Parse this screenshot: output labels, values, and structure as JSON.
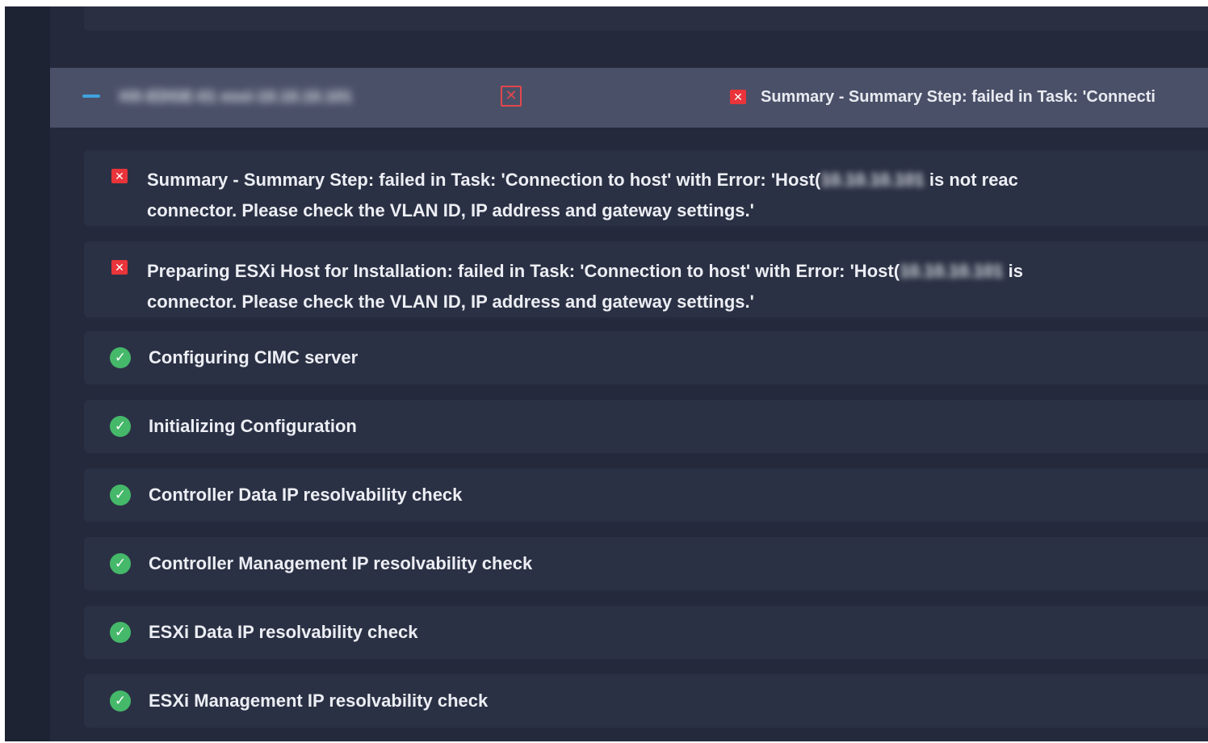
{
  "group": {
    "collapse_label": "—",
    "host_label": "HX-EDGE-01 esxi-10.10.10.101",
    "remove_icon": "✕",
    "status": {
      "icon": "error-icon",
      "message": "Summary - Summary Step: failed in Task: 'Connecti"
    }
  },
  "steps": [
    {
      "status": "error",
      "icon": "error-icon",
      "line1_pre": "Summary - Summary Step: failed in Task: 'Connection to host' with Error: 'Host(",
      "line1_redacted": "10.10.10.101",
      "line1_post": " is not reac",
      "line2": "connector. Please check the VLAN ID, IP address and gateway settings.'"
    },
    {
      "status": "error",
      "icon": "error-icon",
      "line1_pre": "Preparing ESXi Host for Installation: failed in Task: 'Connection to host' with Error: 'Host(",
      "line1_redacted": "10.10.10.101",
      "line1_post": " is",
      "line2": "connector. Please check the VLAN ID, IP address and gateway settings.'"
    },
    {
      "status": "success",
      "icon": "check-circle-icon",
      "label": "Configuring CIMC server"
    },
    {
      "status": "success",
      "icon": "check-circle-icon",
      "label": "Initializing Configuration"
    },
    {
      "status": "success",
      "icon": "check-circle-icon",
      "label": "Controller Data IP resolvability check"
    },
    {
      "status": "success",
      "icon": "check-circle-icon",
      "label": "Controller Management IP resolvability check"
    },
    {
      "status": "success",
      "icon": "check-circle-icon",
      "label": "ESXi Data IP resolvability check"
    },
    {
      "status": "success",
      "icon": "check-circle-icon",
      "label": "ESXi Management IP resolvability check"
    }
  ],
  "colors": {
    "background": "#242a3c",
    "header_bar": "#4a5068",
    "step_card": "#2b3144",
    "error": "#e8343a",
    "success": "#45b86a",
    "accent": "#3fa2dc"
  }
}
